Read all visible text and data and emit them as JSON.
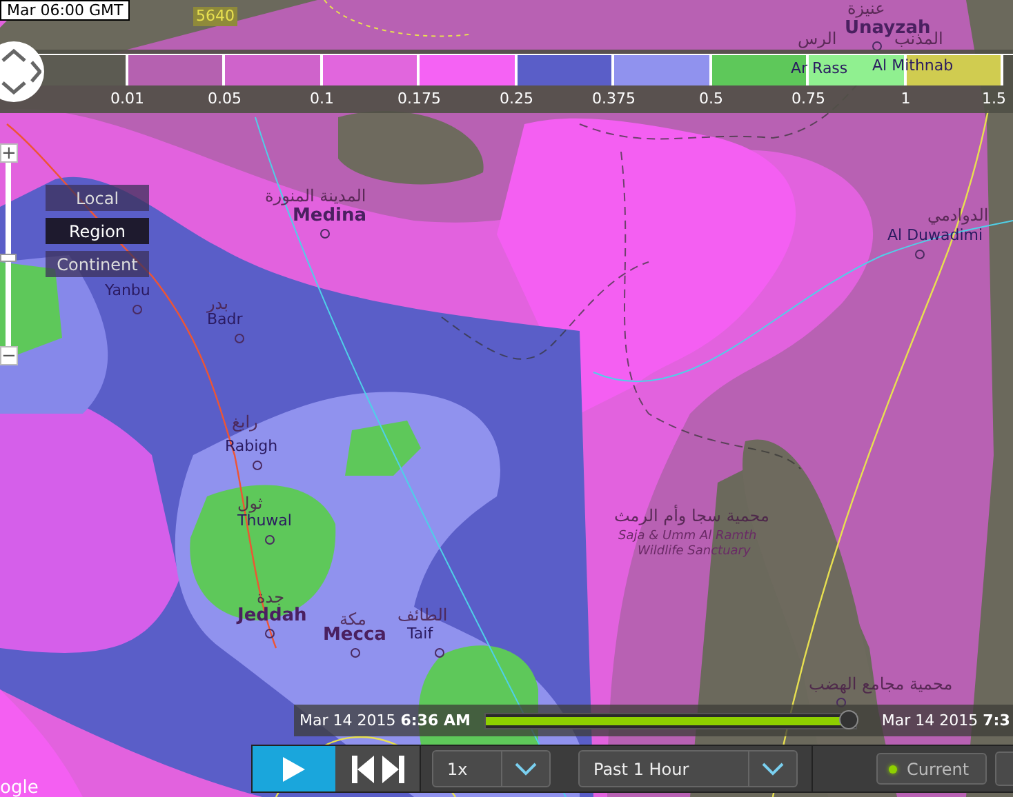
{
  "timestamp_label": "Mar 06:00 GMT",
  "contour_label": "5640",
  "legend": {
    "swatches": [
      {
        "color": "#5c5b52"
      },
      {
        "color": "#b561b0"
      },
      {
        "color": "#cf63cb"
      },
      {
        "color": "#e166dd"
      },
      {
        "color": "#f562f4"
      },
      {
        "color": "#5a5ec8"
      },
      {
        "color": "#9092ee"
      },
      {
        "color": "#5ec85a"
      },
      {
        "color": "#90f090"
      },
      {
        "color": "#d0cc50"
      }
    ],
    "labels": [
      "0.01",
      "0.05",
      "0.1",
      "0.175",
      "0.25",
      "0.375",
      "0.5",
      "0.75",
      "1",
      "1.5"
    ]
  },
  "zoom_control": {
    "zoom_in": "+",
    "zoom_out": "−",
    "level": 0.52
  },
  "view_buttons": [
    {
      "label": "Local",
      "selected": false
    },
    {
      "label": "Region",
      "selected": true
    },
    {
      "label": "Continent",
      "selected": false
    }
  ],
  "places": [
    {
      "text": "عنيزة",
      "kind": "arabic"
    },
    {
      "text": "Unayzah",
      "kind": "city"
    },
    {
      "text": "الرس",
      "kind": "arabic"
    },
    {
      "text": "Ar Rass",
      "kind": "town"
    },
    {
      "text": "المذنب",
      "kind": "arabic"
    },
    {
      "text": "Al Mithnab",
      "kind": "town"
    },
    {
      "text": "المدينة المنورة",
      "kind": "arabic"
    },
    {
      "text": "Medina",
      "kind": "city"
    },
    {
      "text": "الدوادمي",
      "kind": "arabic"
    },
    {
      "text": "Al Duwadimi",
      "kind": "town"
    },
    {
      "text": "Yanbu",
      "kind": "town"
    },
    {
      "text": "بدر",
      "kind": "arabic"
    },
    {
      "text": "Badr",
      "kind": "town"
    },
    {
      "text": "رابغ",
      "kind": "arabic"
    },
    {
      "text": "Rabigh",
      "kind": "town"
    },
    {
      "text": "محمية سجا وأم الرمث",
      "kind": "arabic"
    },
    {
      "text": "Saja & Umm Al Ramth",
      "kind": "park"
    },
    {
      "text": "Wildlife Sanctuary",
      "kind": "park"
    },
    {
      "text": "ثول",
      "kind": "arabic"
    },
    {
      "text": "Thuwal",
      "kind": "town"
    },
    {
      "text": "جدة",
      "kind": "arabic"
    },
    {
      "text": "Jeddah",
      "kind": "city"
    },
    {
      "text": "مكة",
      "kind": "arabic"
    },
    {
      "text": "Mecca",
      "kind": "city"
    },
    {
      "text": "الطائف",
      "kind": "arabic"
    },
    {
      "text": "Taif",
      "kind": "town"
    },
    {
      "text": "محمية مجامع الهضب",
      "kind": "arabic"
    },
    {
      "text": "ogle",
      "kind": "credit"
    }
  ],
  "timeline": {
    "start_date": "Mar 14 2015",
    "start_time": "6:36 AM",
    "level": 0.98,
    "end_date": "Mar 14 2015",
    "end_time": "7:3"
  },
  "toolbar": {
    "speed": "1x",
    "range": "Past 1 Hour",
    "current": {
      "label": "Current",
      "on": true
    }
  }
}
